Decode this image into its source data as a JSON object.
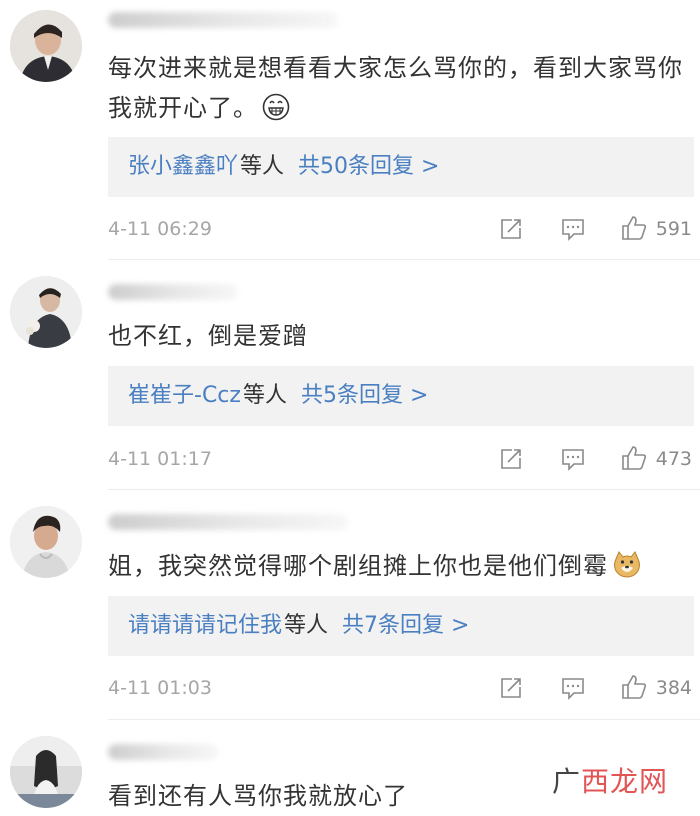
{
  "comments": [
    {
      "text": "每次进来就是想看看大家怎么骂你的，看到大家骂你我就开心了。",
      "emoji": "grin-emoji",
      "reply": {
        "users": "张小鑫鑫吖",
        "mid": "等人",
        "count": "共50条回复 >"
      },
      "time": "4-11 06:29",
      "likes": "591"
    },
    {
      "text": "也不红，倒是爱蹭",
      "reply": {
        "users": "崔崔子-Ccz",
        "mid": "等人",
        "count": "共5条回复 >"
      },
      "time": "4-11 01:17",
      "likes": "473"
    },
    {
      "text": "姐，我突然觉得哪个剧组摊上你也是他们倒霉",
      "emoji": "doge-emoji",
      "reply": {
        "users": "请请请请记住我",
        "mid": "等人",
        "count": "共7条回复 >"
      },
      "time": "4-11 01:03",
      "likes": "384"
    },
    {
      "text": "看到还有人骂你我就放心了"
    }
  ],
  "watermark": {
    "icon": "广",
    "text": "西龙网"
  },
  "colors": {
    "link": "#4a7fc1",
    "reply_bg": "#f2f2f2",
    "meta": "#a6a6a6",
    "watermark": "#e25555"
  }
}
